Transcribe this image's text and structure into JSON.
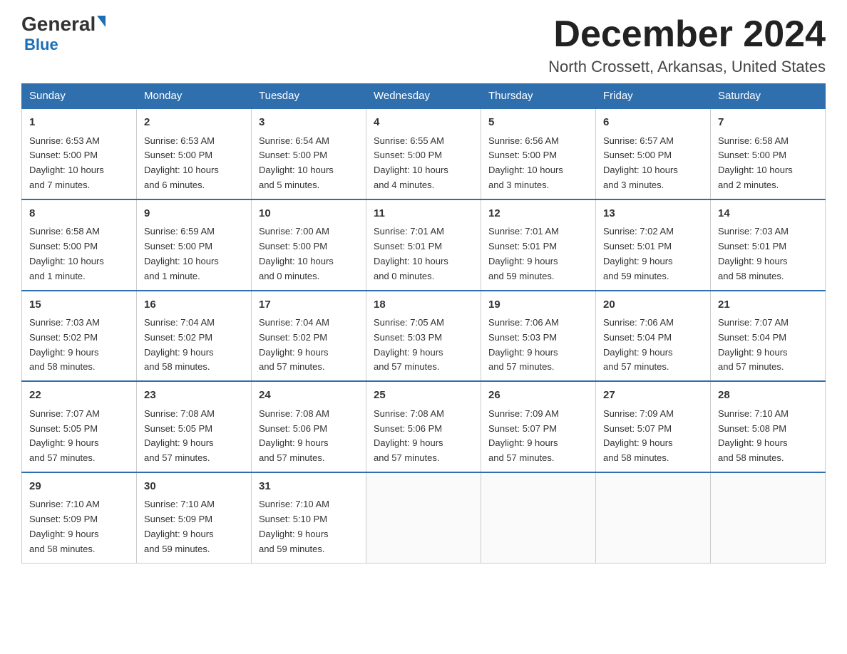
{
  "header": {
    "logo_general": "General",
    "logo_blue": "Blue",
    "title": "December 2024",
    "subtitle": "North Crossett, Arkansas, United States"
  },
  "days_of_week": [
    "Sunday",
    "Monday",
    "Tuesday",
    "Wednesday",
    "Thursday",
    "Friday",
    "Saturday"
  ],
  "weeks": [
    [
      {
        "day": "1",
        "sunrise": "6:53 AM",
        "sunset": "5:00 PM",
        "daylight": "10 hours and 7 minutes."
      },
      {
        "day": "2",
        "sunrise": "6:53 AM",
        "sunset": "5:00 PM",
        "daylight": "10 hours and 6 minutes."
      },
      {
        "day": "3",
        "sunrise": "6:54 AM",
        "sunset": "5:00 PM",
        "daylight": "10 hours and 5 minutes."
      },
      {
        "day": "4",
        "sunrise": "6:55 AM",
        "sunset": "5:00 PM",
        "daylight": "10 hours and 4 minutes."
      },
      {
        "day": "5",
        "sunrise": "6:56 AM",
        "sunset": "5:00 PM",
        "daylight": "10 hours and 3 minutes."
      },
      {
        "day": "6",
        "sunrise": "6:57 AM",
        "sunset": "5:00 PM",
        "daylight": "10 hours and 3 minutes."
      },
      {
        "day": "7",
        "sunrise": "6:58 AM",
        "sunset": "5:00 PM",
        "daylight": "10 hours and 2 minutes."
      }
    ],
    [
      {
        "day": "8",
        "sunrise": "6:58 AM",
        "sunset": "5:00 PM",
        "daylight": "10 hours and 1 minute."
      },
      {
        "day": "9",
        "sunrise": "6:59 AM",
        "sunset": "5:00 PM",
        "daylight": "10 hours and 1 minute."
      },
      {
        "day": "10",
        "sunrise": "7:00 AM",
        "sunset": "5:00 PM",
        "daylight": "10 hours and 0 minutes."
      },
      {
        "day": "11",
        "sunrise": "7:01 AM",
        "sunset": "5:01 PM",
        "daylight": "10 hours and 0 minutes."
      },
      {
        "day": "12",
        "sunrise": "7:01 AM",
        "sunset": "5:01 PM",
        "daylight": "9 hours and 59 minutes."
      },
      {
        "day": "13",
        "sunrise": "7:02 AM",
        "sunset": "5:01 PM",
        "daylight": "9 hours and 59 minutes."
      },
      {
        "day": "14",
        "sunrise": "7:03 AM",
        "sunset": "5:01 PM",
        "daylight": "9 hours and 58 minutes."
      }
    ],
    [
      {
        "day": "15",
        "sunrise": "7:03 AM",
        "sunset": "5:02 PM",
        "daylight": "9 hours and 58 minutes."
      },
      {
        "day": "16",
        "sunrise": "7:04 AM",
        "sunset": "5:02 PM",
        "daylight": "9 hours and 58 minutes."
      },
      {
        "day": "17",
        "sunrise": "7:04 AM",
        "sunset": "5:02 PM",
        "daylight": "9 hours and 57 minutes."
      },
      {
        "day": "18",
        "sunrise": "7:05 AM",
        "sunset": "5:03 PM",
        "daylight": "9 hours and 57 minutes."
      },
      {
        "day": "19",
        "sunrise": "7:06 AM",
        "sunset": "5:03 PM",
        "daylight": "9 hours and 57 minutes."
      },
      {
        "day": "20",
        "sunrise": "7:06 AM",
        "sunset": "5:04 PM",
        "daylight": "9 hours and 57 minutes."
      },
      {
        "day": "21",
        "sunrise": "7:07 AM",
        "sunset": "5:04 PM",
        "daylight": "9 hours and 57 minutes."
      }
    ],
    [
      {
        "day": "22",
        "sunrise": "7:07 AM",
        "sunset": "5:05 PM",
        "daylight": "9 hours and 57 minutes."
      },
      {
        "day": "23",
        "sunrise": "7:08 AM",
        "sunset": "5:05 PM",
        "daylight": "9 hours and 57 minutes."
      },
      {
        "day": "24",
        "sunrise": "7:08 AM",
        "sunset": "5:06 PM",
        "daylight": "9 hours and 57 minutes."
      },
      {
        "day": "25",
        "sunrise": "7:08 AM",
        "sunset": "5:06 PM",
        "daylight": "9 hours and 57 minutes."
      },
      {
        "day": "26",
        "sunrise": "7:09 AM",
        "sunset": "5:07 PM",
        "daylight": "9 hours and 57 minutes."
      },
      {
        "day": "27",
        "sunrise": "7:09 AM",
        "sunset": "5:07 PM",
        "daylight": "9 hours and 58 minutes."
      },
      {
        "day": "28",
        "sunrise": "7:10 AM",
        "sunset": "5:08 PM",
        "daylight": "9 hours and 58 minutes."
      }
    ],
    [
      {
        "day": "29",
        "sunrise": "7:10 AM",
        "sunset": "5:09 PM",
        "daylight": "9 hours and 58 minutes."
      },
      {
        "day": "30",
        "sunrise": "7:10 AM",
        "sunset": "5:09 PM",
        "daylight": "9 hours and 59 minutes."
      },
      {
        "day": "31",
        "sunrise": "7:10 AM",
        "sunset": "5:10 PM",
        "daylight": "9 hours and 59 minutes."
      },
      null,
      null,
      null,
      null
    ]
  ],
  "labels": {
    "sunrise": "Sunrise:",
    "sunset": "Sunset:",
    "daylight": "Daylight:"
  }
}
